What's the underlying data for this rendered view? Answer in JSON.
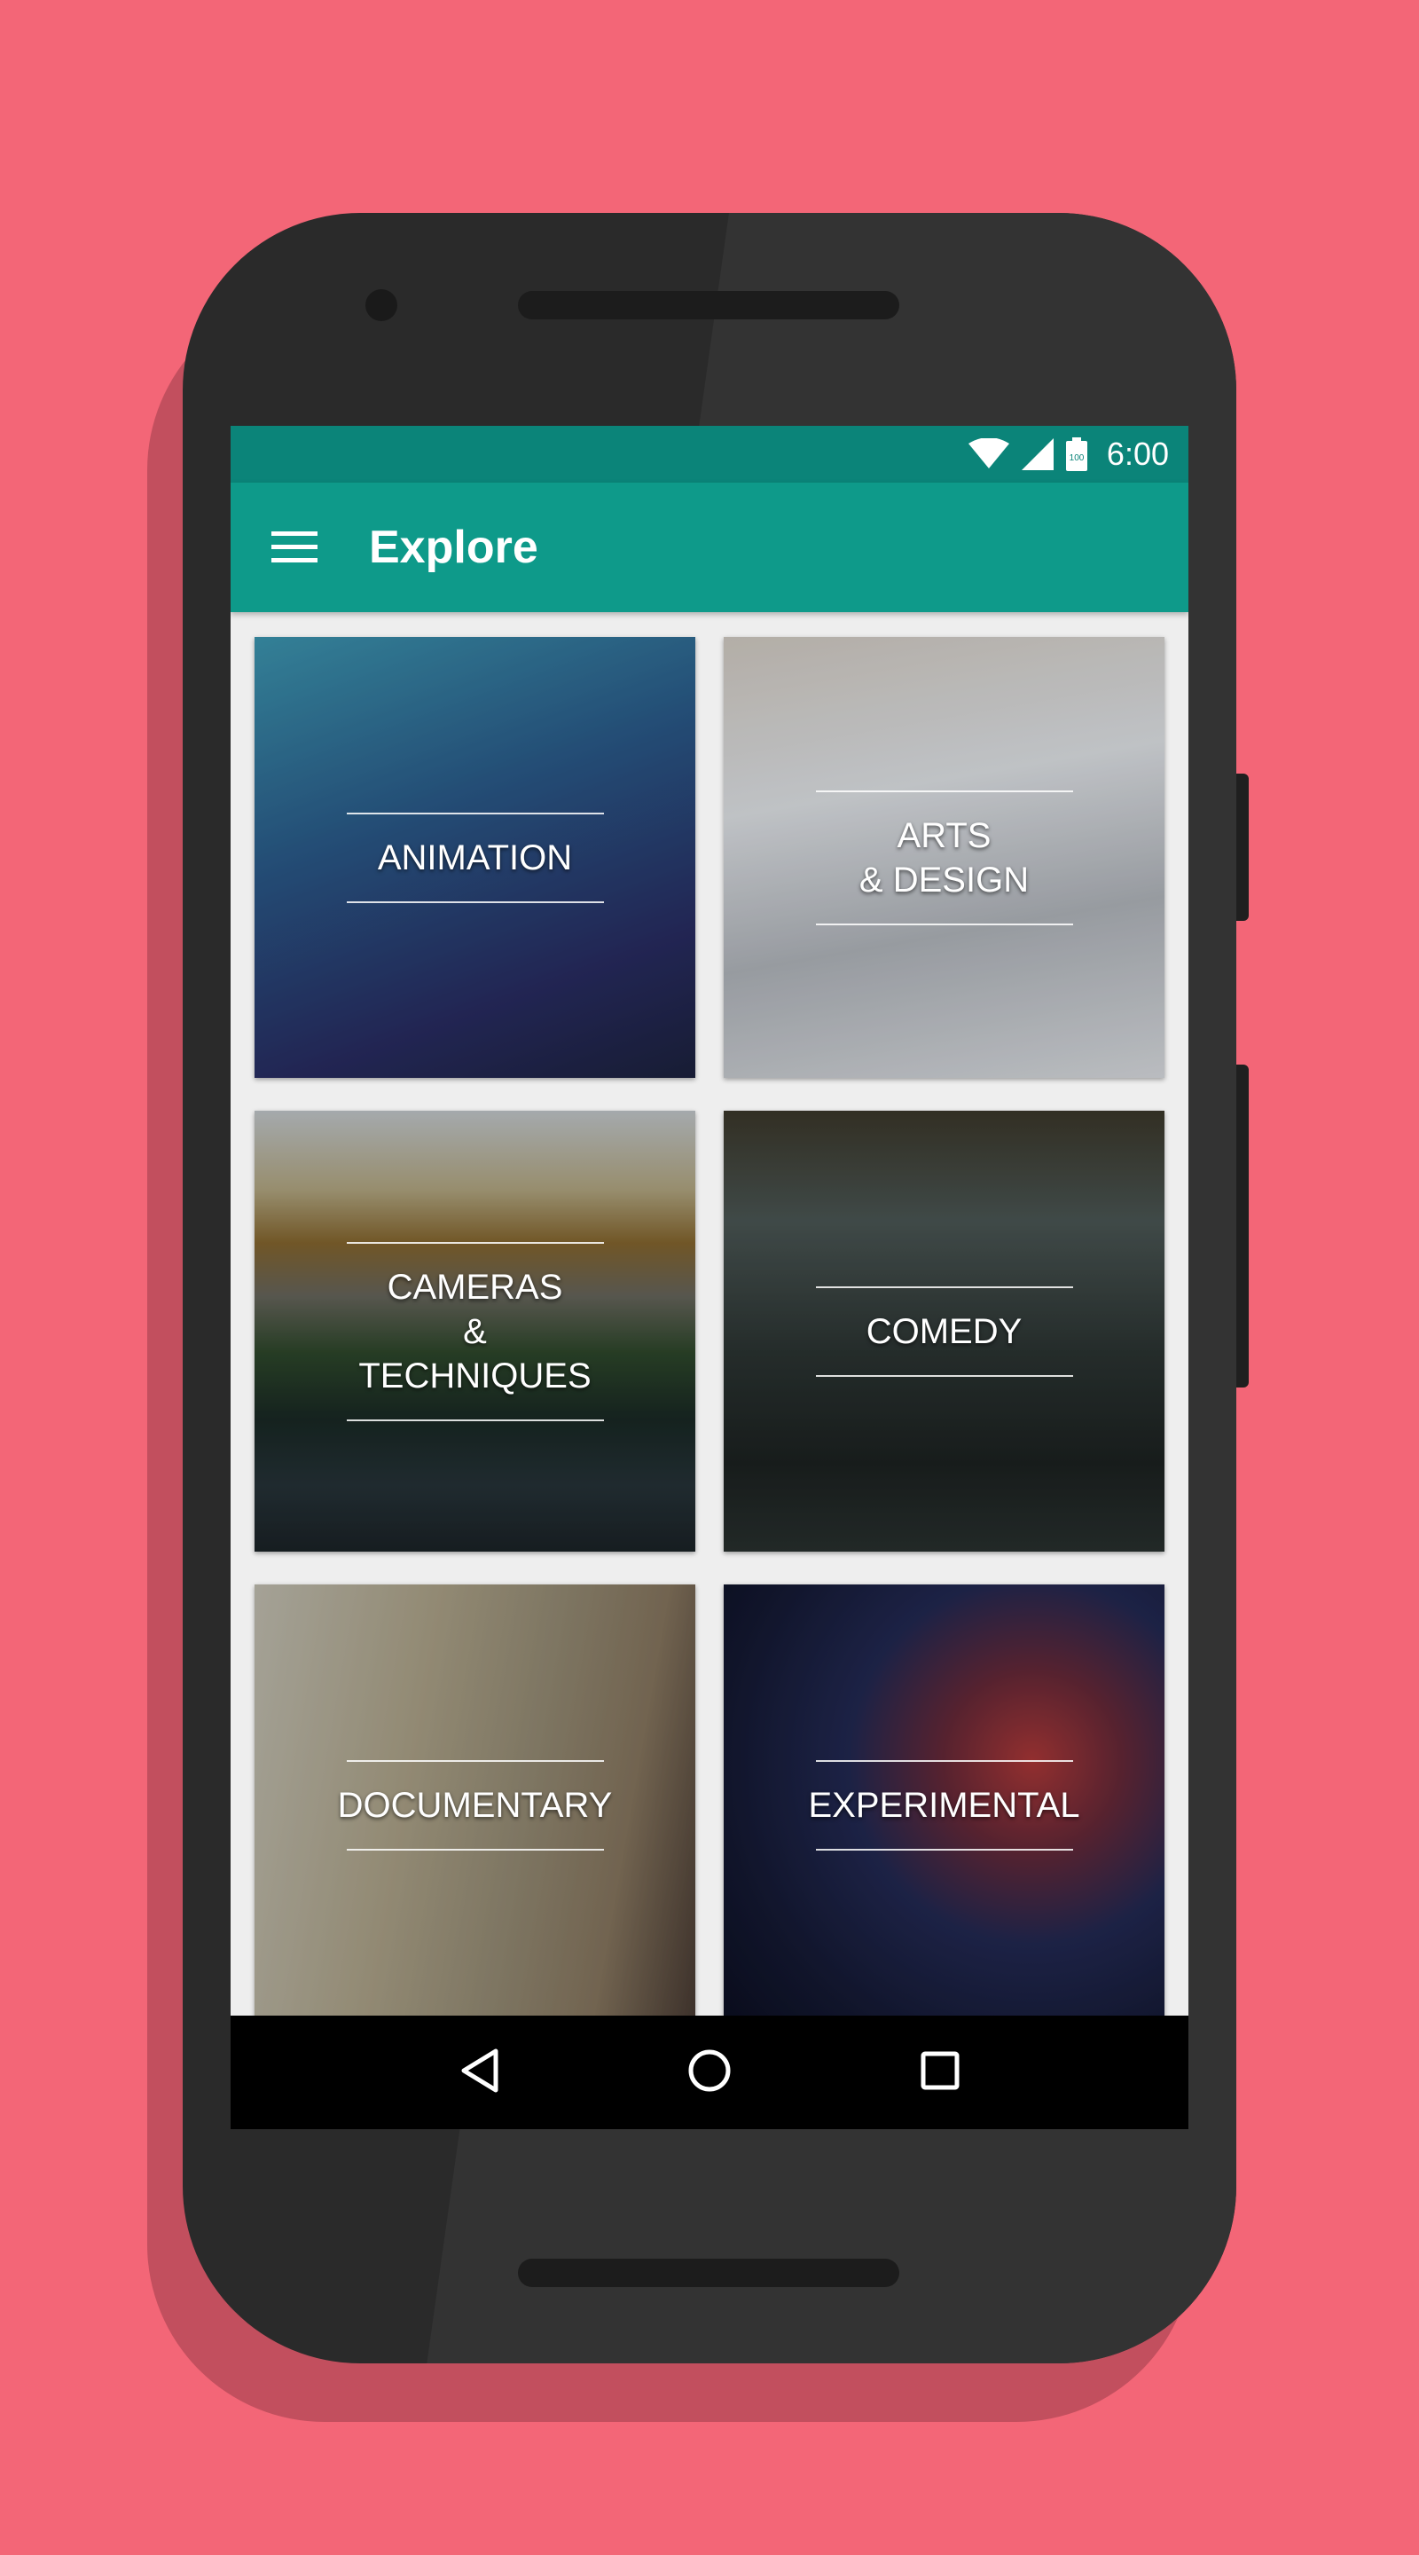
{
  "status_bar": {
    "time": "6:00",
    "battery_level": "100",
    "icons": [
      "wifi-icon",
      "cell-signal-icon",
      "battery-icon"
    ]
  },
  "app_bar": {
    "title": "Explore",
    "menu_icon": "hamburger-menu-icon"
  },
  "categories": [
    {
      "label": "ANIMATION",
      "bg": "#2c4a7a"
    },
    {
      "label": "ARTS\n& DESIGN",
      "bg": "#b9bcc0"
    },
    {
      "label": "CAMERAS\n& TECHNIQUES",
      "bg": "#3e4a3a"
    },
    {
      "label": "COMEDY",
      "bg": "#2f3a38"
    },
    {
      "label": "DOCUMENTARY",
      "bg": "#a39b88"
    },
    {
      "label": "EXPERIMENTAL",
      "bg": "#1c2140"
    }
  ],
  "nav_bar": {
    "buttons": [
      "back-icon",
      "home-icon",
      "recents-icon"
    ]
  },
  "colors": {
    "background": "#f36677",
    "status_bar": "#0b8479",
    "app_bar": "#0e9a8a",
    "phone_body": "#2a2a2a"
  }
}
